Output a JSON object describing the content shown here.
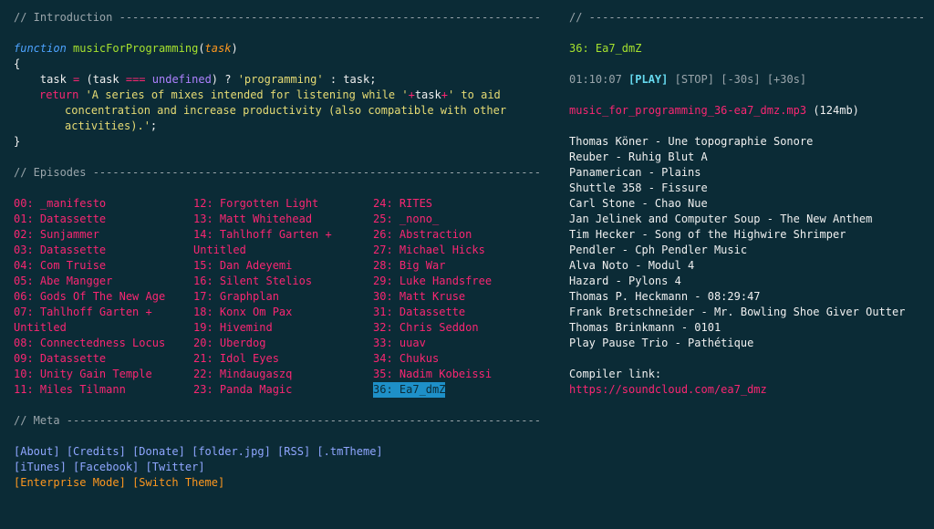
{
  "intro": {
    "header": "// Introduction -------------------------------------------------------------------",
    "code": {
      "kw_function": "function",
      "fn_name": "musicForProgramming",
      "paren_open": "(",
      "param": "task",
      "paren_close": ")",
      "brace_open": "{",
      "line2_a": "    task ",
      "line2_eq": "=",
      "line2_b": " (task ",
      "line2_strict": "===",
      "line2_c": " ",
      "line2_undef": "undefined",
      "line2_d": ") ? ",
      "line2_str": "'programming'",
      "line2_e": " : task;",
      "line3_ret": "return",
      "line3_str1": " 'A series of mixes intended for listening while '",
      "line3_plus1": "+",
      "line3_task": "task",
      "line3_plus2": "+",
      "line3_str2": "' to aid",
      "line4": "concentration and increase productivity (also compatible with other",
      "line5": "activities).'",
      "line5_end": ";",
      "brace_close": "}"
    }
  },
  "episodes": {
    "header": "// Episodes ---------------------------------------------------------------------",
    "columns": [
      [
        "00: _manifesto",
        "01: Datassette",
        "02: Sunjammer",
        "03: Datassette",
        "04: Com Truise",
        "05: Abe Mangger",
        "06: Gods Of The New Age",
        "07: Tahlhoff Garten + Untitled",
        "08: Connectedness Locus",
        "09: Datassette",
        "10: Unity Gain Temple",
        "11: Miles Tilmann"
      ],
      [
        "12: Forgotten Light",
        "13: Matt Whitehead",
        "14: Tahlhoff Garten + Untitled",
        "15: Dan Adeyemi",
        "16: Silent Stelios",
        "17: Graphplan",
        "18: Konx Om Pax",
        "19: Hivemind",
        "20: Uberdog",
        "21: Idol Eyes",
        "22: Mindaugaszq",
        "23: Panda Magic"
      ],
      [
        "24: RITES",
        "25: _nono_",
        "26: Abstraction",
        "27: Michael Hicks",
        "28: Big War",
        "29: Luke Handsfree",
        "30: Matt Kruse",
        "31: Datassette",
        "32: Chris Seddon",
        "33: uuav",
        "34: Chukus",
        "35: Nadim Kobeissi",
        "36: Ea7_dmZ"
      ]
    ],
    "active": "36: Ea7_dmZ"
  },
  "meta": {
    "header": "// Meta -------------------------------------------------------------------------",
    "row1": [
      "[About]",
      "[Credits]",
      "[Donate]",
      "[folder.jpg]",
      "[RSS]",
      "[.tmTheme]"
    ],
    "row2": [
      "[iTunes]",
      "[Facebook]",
      "[Twitter]"
    ],
    "row3": [
      "[Enterprise Mode]",
      "[Switch Theme]"
    ]
  },
  "player": {
    "header": "// ---------------------------------------------------------",
    "title": "36: Ea7_dmZ",
    "time": "01:10:07",
    "play": "[PLAY]",
    "stop": "[STOP]",
    "back": "[-30s]",
    "fwd": "[+30s]",
    "file": "music_for_programming_36-ea7_dmz.mp3",
    "size": "(124mb)",
    "tracks": [
      "Thomas Köner - Une topographie Sonore",
      "Reuber - Ruhig Blut A",
      "Panamerican - Plains",
      "Shuttle 358 - Fissure",
      "Carl Stone - Chao Nue",
      "Jan Jelinek and Computer Soup - The New Anthem",
      "Tim Hecker - Song of the Highwire Shrimper",
      "Pendler - Cph Pendler Music",
      "Alva Noto - Modul 4",
      "Hazard - Pylons 4",
      "Thomas P. Heckmann - 08:29:47",
      "Frank Bretschneider - Mr. Bowling Shoe Giver Outter",
      "Thomas Brinkmann - 0101",
      "Play Pause Trio - Pathétique"
    ],
    "compiler_label": "Compiler link:",
    "compiler_url": "https://soundcloud.com/ea7_dmz"
  },
  "colors": {
    "background": "#0b2b36",
    "episode": "#f92672",
    "active_bg": "#1e90c8",
    "link": "#8fa6ff",
    "orange": "#fd971f",
    "green": "#a6e22e"
  }
}
